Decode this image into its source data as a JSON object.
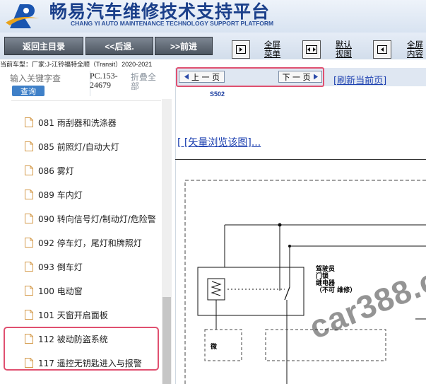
{
  "header": {
    "title": "畅易汽车维修技术支持平台",
    "subtitle": "CHANG YI AUTO MAINTENANCE TECHNOLOGY SUPPORT PLATFORM",
    "brand_color": "#1a3f8a"
  },
  "toolbar": {
    "home_label": "返回主目录",
    "back_label": "<<后退.",
    "forward_label": ">>前进",
    "fullscreen_menu": [
      "全屏",
      "菜单"
    ],
    "default_view": [
      "默认",
      "视图"
    ],
    "fullscreen_content": [
      "全屏",
      "内容"
    ]
  },
  "vehicle_info": "当前车型：厂家:J-江铃福特全顺（Transit）2020-2021",
  "sidebar": {
    "search_placeholder": "输入关键字查",
    "search_button": "查询",
    "pc_code": "PC.153-24679",
    "collapse_all": "折叠全部",
    "items": [
      {
        "label": "081 雨刮器和洗涤器"
      },
      {
        "label": "085 前照灯/自动大灯"
      },
      {
        "label": "086 雾灯"
      },
      {
        "label": "089 车内灯"
      },
      {
        "label": "090 转向信号灯/制动灯/危险警"
      },
      {
        "label": "092 停车灯，尾灯和牌照灯"
      },
      {
        "label": "093 倒车灯"
      },
      {
        "label": "100 电动窗"
      },
      {
        "label": "101 天窗开启面板"
      },
      {
        "label": "112 被动防盗系统"
      },
      {
        "label": "117 遥控无钥匙进入与报警"
      }
    ],
    "highlight_color": "#e05070"
  },
  "content": {
    "prev_page": "上 一 页",
    "next_page": "下 一 页",
    "refresh": "[刷新当前页]",
    "code": "S502",
    "vector_view": "[ [矢量浏览该图]...",
    "diagram_label": [
      "驾驶员",
      "门锁",
      "继电器",
      "（不可 维修）"
    ],
    "micro_label": "微",
    "watermark": "car388.c"
  }
}
